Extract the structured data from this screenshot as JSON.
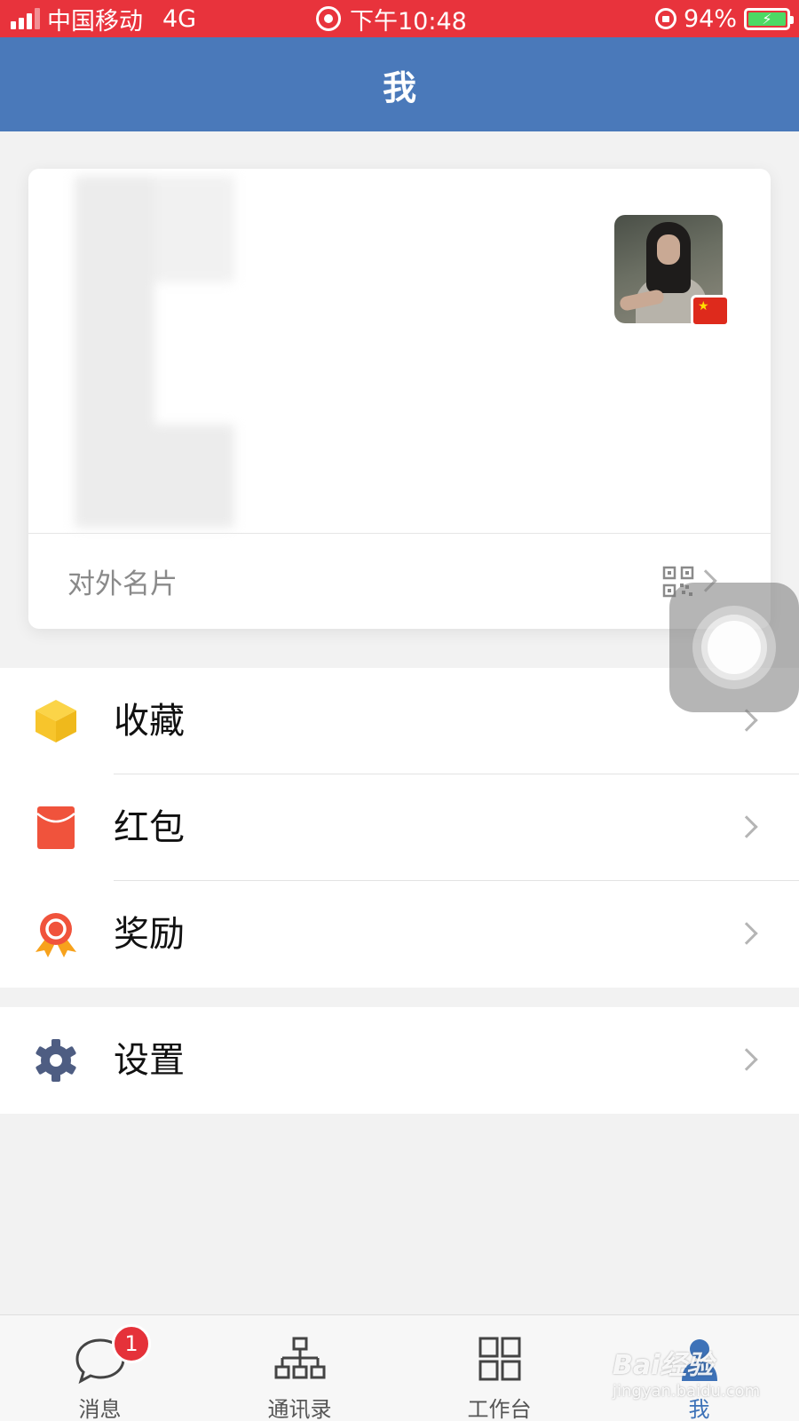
{
  "status_bar": {
    "carrier": "中国移动",
    "network": "4G",
    "time": "下午10:48",
    "battery": "94%",
    "background_color": "#e8333c"
  },
  "header": {
    "title": "我",
    "background_color": "#4a79ba"
  },
  "profile_card": {
    "external_card_label": "对外名片"
  },
  "menu": {
    "group1": [
      {
        "label": "收藏",
        "icon": "box-icon",
        "color": "#f7c52c"
      },
      {
        "label": "红包",
        "icon": "red-envelope-icon",
        "color": "#f0533c"
      },
      {
        "label": "奖励",
        "icon": "award-ribbon-icon",
        "color": "#f0533c"
      }
    ],
    "group2": [
      {
        "label": "设置",
        "icon": "gear-icon",
        "color": "#4e5d82"
      }
    ]
  },
  "tabbar": {
    "tabs": [
      {
        "label": "消息",
        "icon": "chat-bubble-icon",
        "badge": "1"
      },
      {
        "label": "通讯录",
        "icon": "org-chart-icon"
      },
      {
        "label": "工作台",
        "icon": "grid-icon"
      },
      {
        "label": "我",
        "icon": "person-icon",
        "active": true
      }
    ],
    "active_color": "#3d72b8"
  },
  "watermark": {
    "brand": "Bai经验",
    "url": "jingyan.baidu.com"
  }
}
